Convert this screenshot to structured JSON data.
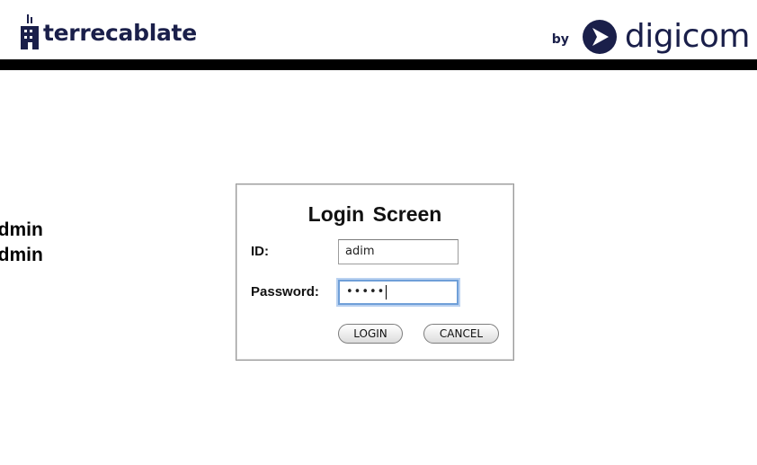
{
  "header": {
    "brand": "terrecablate",
    "by": "by",
    "partner": "digicom",
    "brand_color": "#1a1f4a"
  },
  "hint": {
    "line1": "admin",
    "line2": "admin"
  },
  "login": {
    "title": "Login  Screen",
    "id_label": "ID:",
    "id_value": "adim",
    "password_label": "Password:",
    "password_masked": "•••••",
    "login_button": "LOGIN",
    "cancel_button": "CANCEL",
    "focus_color": "#6f9fd8"
  },
  "icons": [
    "building-icon",
    "digicom-arrow-icon"
  ]
}
